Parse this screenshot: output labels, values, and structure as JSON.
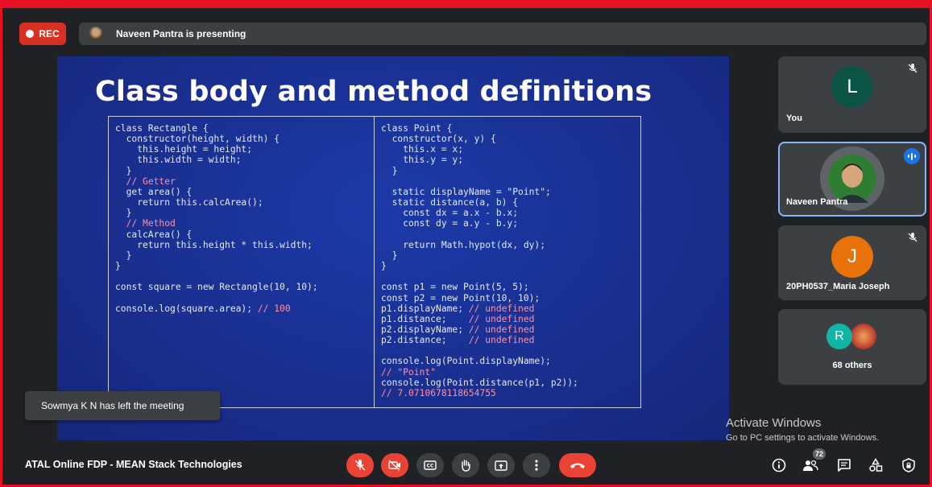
{
  "recording": {
    "label": "REC"
  },
  "presenter_bar": {
    "text": "Naveen Pantra is presenting"
  },
  "slide": {
    "title": "Class body and method definitions",
    "left_code": "class Rectangle {\n  constructor(height, width) {\n    this.height = height;\n    this.width = width;\n  }\n  // Getter\n  get area() {\n    return this.calcArea();\n  }\n  // Method\n  calcArea() {\n    return this.height * this.width;\n  }\n}\n\nconst square = new Rectangle(10, 10);\n\nconsole.log(square.area); // 100",
    "right_code": "class Point {\n  constructor(x, y) {\n    this.x = x;\n    this.y = y;\n  }\n\n  static displayName = \"Point\";\n  static distance(a, b) {\n    const dx = a.x - b.x;\n    const dy = a.y - b.y;\n\n    return Math.hypot(dx, dy);\n  }\n}\n\nconst p1 = new Point(5, 5);\nconst p2 = new Point(10, 10);\np1.displayName; // undefined\np1.distance;    // undefined\np2.displayName; // undefined\np2.distance;    // undefined\n\nconsole.log(Point.displayName);\n// \"Point\"\nconsole.log(Point.distance(p1, p2));\n// 7.0710678118654755"
  },
  "toast": {
    "text": "Sowmya K N has left the meeting"
  },
  "participants": [
    {
      "name": "You",
      "initial": "L",
      "color": "#0b5345",
      "muted": true
    },
    {
      "name": "Naveen Pantra",
      "speaking": true,
      "active": true
    },
    {
      "name": "20PH0537_Maria Joseph",
      "initial": "J",
      "color": "#e8710a",
      "muted": true
    },
    {
      "name": "68 others",
      "initial": "R",
      "color": "#12b5a5"
    }
  ],
  "watermark": {
    "line1": "Activate Windows",
    "line2": "Go to PC settings to activate Windows."
  },
  "meeting_title": "ATAL Online FDP - MEAN Stack Technologies",
  "controls": [
    "mic-off-icon",
    "camera-off-icon",
    "captions-icon",
    "raise-hand-icon",
    "present-icon",
    "more-icon",
    "end-call-icon"
  ],
  "right_controls": {
    "people_count": "72"
  },
  "colors": {
    "danger": "#ea4335",
    "accent": "#1a73e8",
    "tile_bg": "#3c4043",
    "bg": "#202124",
    "slide_bg": "#1a2f90"
  }
}
